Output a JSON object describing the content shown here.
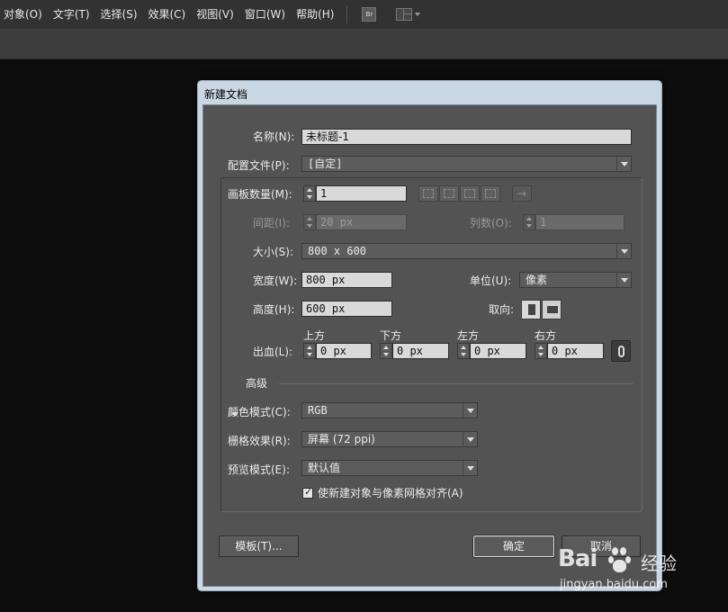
{
  "menubar": {
    "items": [
      "对象(O)",
      "文字(T)",
      "选择(S)",
      "效果(C)",
      "视图(V)",
      "窗口(W)",
      "帮助(H)"
    ],
    "bridge_label": "Br"
  },
  "dialog": {
    "title": "新建文档",
    "name_label": "名称(N):",
    "name_value": "未标题-1",
    "profile_label": "配置文件(P):",
    "profile_value": "[自定]",
    "artboards_label": "画板数量(M):",
    "artboards_value": "1",
    "spacing_label": "间距(I):",
    "spacing_value": "20 px",
    "columns_label": "列数(O):",
    "columns_value": "1",
    "size_label": "大小(S):",
    "size_value": "800 x 600",
    "width_label": "宽度(W):",
    "width_value": "800 px",
    "units_label": "单位(U):",
    "units_value": "像素",
    "height_label": "高度(H):",
    "height_value": "600 px",
    "orientation_label": "取向:",
    "bleed_label": "出血(L):",
    "bleed": {
      "top_label": "上方",
      "top_value": "0 px",
      "bottom_label": "下方",
      "bottom_value": "0 px",
      "left_label": "左方",
      "left_value": "0 px",
      "right_label": "右方",
      "right_value": "0 px"
    },
    "advanced_label": "高级",
    "color_mode_label": "颜色模式(C):",
    "color_mode_value": "RGB",
    "raster_label": "栅格效果(R):",
    "raster_value": "屏幕 (72 ppi)",
    "preview_label": "预览模式(E):",
    "preview_value": "默认值",
    "align_pixel_label": "使新建对象与像素网格对齐(A)",
    "align_pixel_checked": true,
    "template_button": "模板(T)...",
    "ok_button": "确定",
    "cancel_button": "取消"
  },
  "watermark": {
    "brand": "Bai",
    "suffix": "经验",
    "url": "jingyan.baidu.com"
  }
}
